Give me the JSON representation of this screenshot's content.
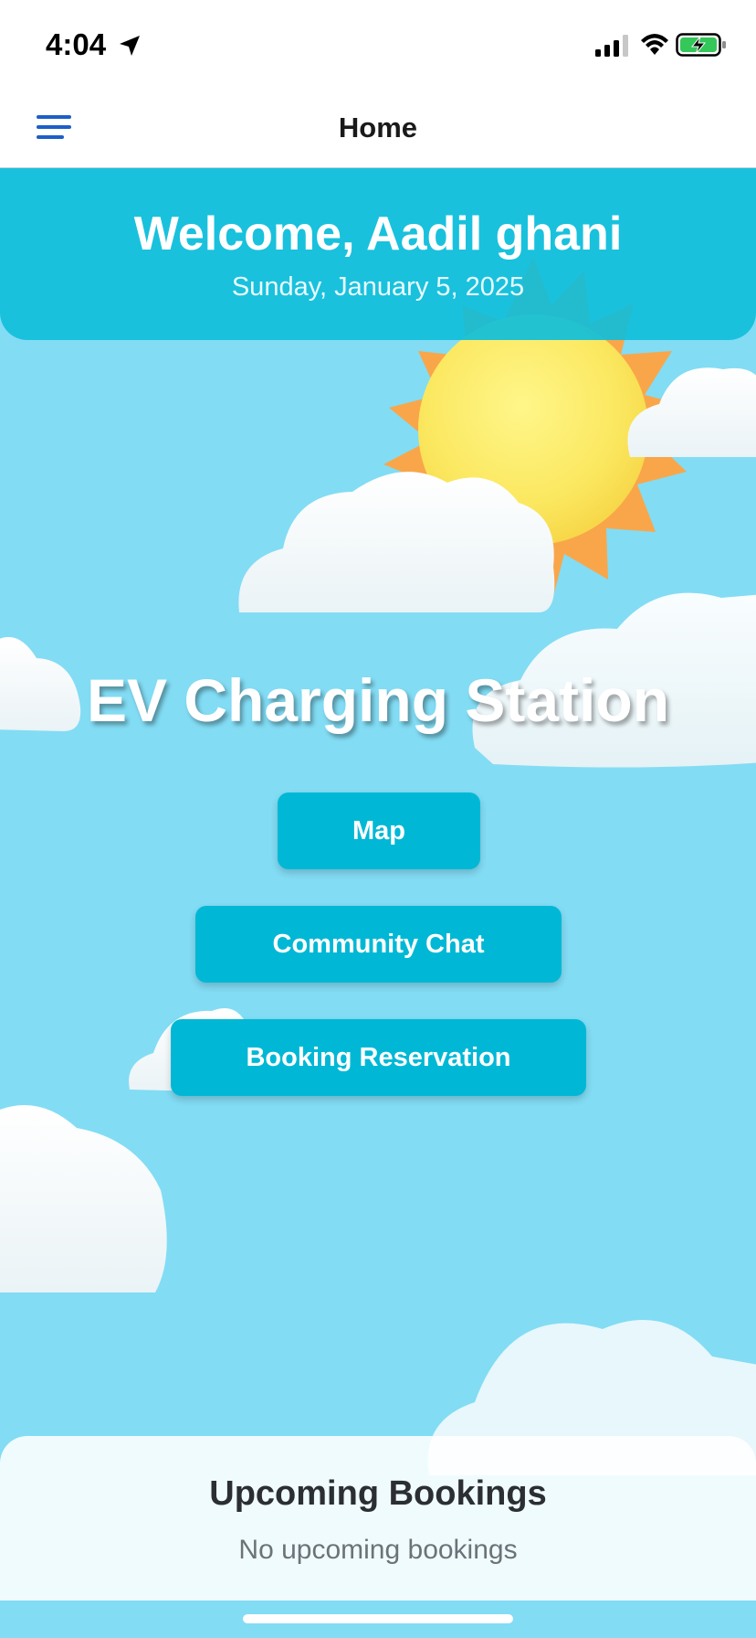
{
  "status_bar": {
    "time": "4:04",
    "icons": [
      "location-arrow-icon",
      "cellular-signal-icon",
      "wifi-icon",
      "battery-charging-icon"
    ]
  },
  "nav": {
    "title": "Home",
    "menu_icon": "hamburger-menu-icon"
  },
  "welcome": {
    "title": "Welcome, Aadil ghani",
    "date": "Sunday, January 5, 2025"
  },
  "main": {
    "title": "EV Charging Station",
    "buttons": {
      "map": "Map",
      "community_chat": "Community Chat",
      "booking": "Booking Reservation"
    }
  },
  "bookings": {
    "title": "Upcoming Bookings",
    "empty_text": "No upcoming bookings"
  },
  "colors": {
    "sky": "#82dcf4",
    "accent": "#00b8d6",
    "header": "#10bedA",
    "menu_icon": "#1d5fc7"
  }
}
